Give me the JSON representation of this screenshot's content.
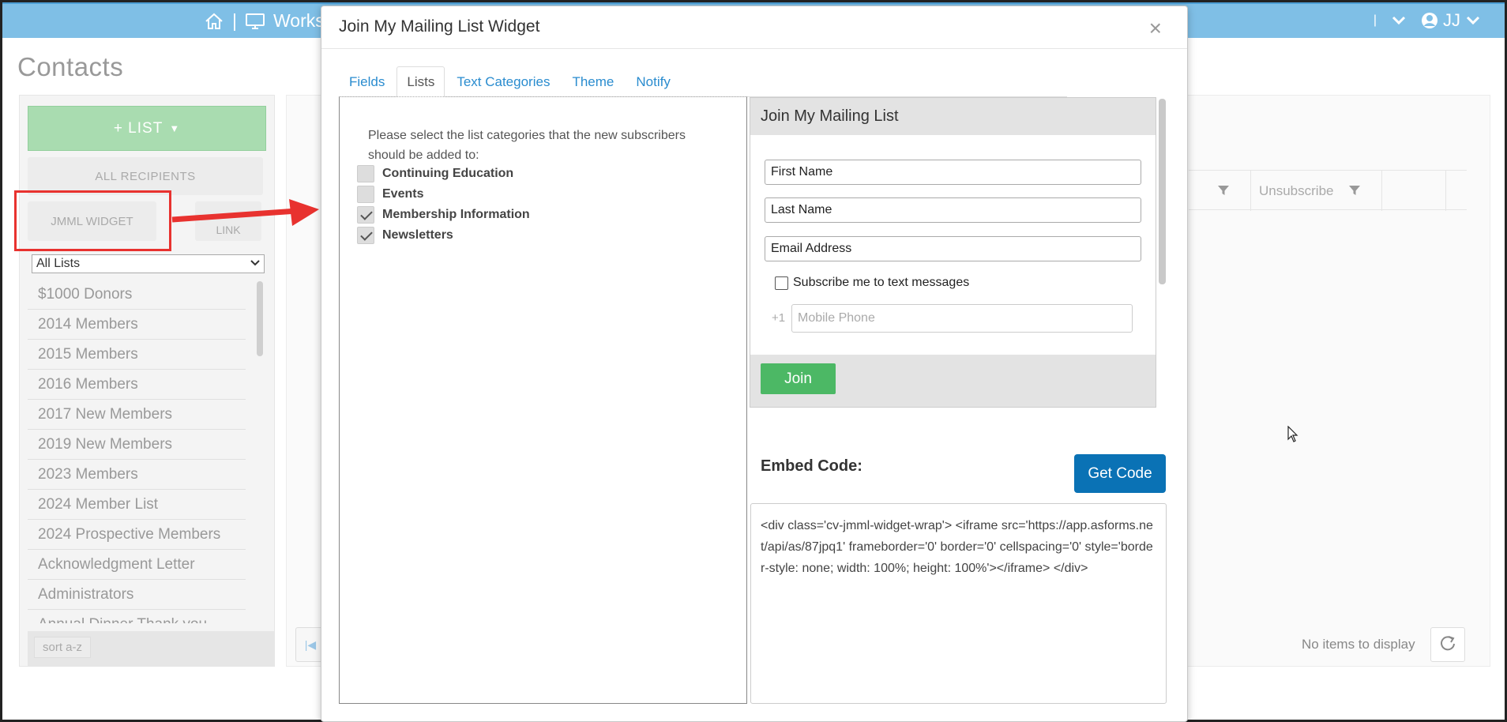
{
  "topbar": {
    "workspace_label": "Works",
    "user_initials": "JJ",
    "separator": "|",
    "right_separator": "|"
  },
  "page": {
    "title": "Contacts"
  },
  "left_panel": {
    "list_button_label": "+ LIST",
    "all_recipients_label": "ALL RECIPIENTS",
    "jmml_widget_label": "JMML WIDGET",
    "link_button_partial": "LINK",
    "list_filter_selected": "All Lists",
    "items": [
      {
        "label": "$1000 Donors"
      },
      {
        "label": "2014 Members"
      },
      {
        "label": "2015 Members"
      },
      {
        "label": "2016 Members"
      },
      {
        "label": "2017 New Members"
      },
      {
        "label": "2019 New Members"
      },
      {
        "label": "2023 Members"
      },
      {
        "label": "2024 Member List"
      },
      {
        "label": "2024 Prospective Members"
      },
      {
        "label": "Acknowledgment Letter"
      },
      {
        "label": "Administrators"
      },
      {
        "label": "Annual Dinner Thank you"
      }
    ],
    "sort_label": "sort a-z"
  },
  "grid": {
    "unsubscribe_header": "Unsubscribe",
    "no_items_text": "No items to display"
  },
  "modal": {
    "title": "Join My Mailing List Widget",
    "close_glyph": "×",
    "tabs": [
      {
        "label": "Fields"
      },
      {
        "label": "Lists"
      },
      {
        "label": "Text Categories"
      },
      {
        "label": "Theme"
      },
      {
        "label": "Notify"
      }
    ],
    "active_tab": "Lists",
    "lists_prompt": "Please select the list categories that the new subscribers should be added to:",
    "list_categories": [
      {
        "label": "Continuing Education",
        "checked": false
      },
      {
        "label": "Events",
        "checked": false
      },
      {
        "label": "Membership Information",
        "checked": true
      },
      {
        "label": "Newsletters",
        "checked": true
      }
    ],
    "preview": {
      "title": "Join My Mailing List",
      "first_name": "First Name",
      "last_name": "Last Name",
      "email": "Email Address",
      "sms_label": "Subscribe me to text messages",
      "phone_prefix": "+1",
      "phone_placeholder": "Mobile Phone",
      "join_label": "Join"
    },
    "embed_label": "Embed Code:",
    "get_code_label": "Get Code",
    "embed_code": "<div class='cv-jmml-widget-wrap'> <iframe src='https://app.asforms.net/api/as/87jpq1' frameborder='0' border='0' cellspacing='0' style='border-style: none; width: 100%; height: 100%'></iframe> </div>"
  },
  "colors": {
    "topbar": "#7fbfe6",
    "list_button": "#a9dcb0",
    "join_button": "#4cb865",
    "get_code_button": "#0a72b5",
    "tab_link": "#2a8ccf",
    "highlight": "#e8322f"
  }
}
